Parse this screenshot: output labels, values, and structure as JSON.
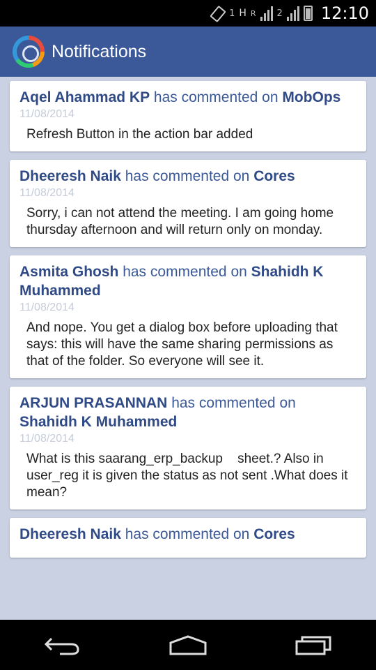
{
  "status_bar": {
    "sim1": "1",
    "net1": "H",
    "roam": "R",
    "sim2": "2",
    "time": "12:10",
    "icons": [
      "screen-rotation-icon",
      "signal-icon",
      "signal-icon",
      "battery-icon"
    ]
  },
  "app_bar": {
    "title": "Notifications",
    "logo_icon": "app-logo-icon"
  },
  "notifications": [
    {
      "author": "Aqel Ahammad KP",
      "action": " has commented on ",
      "target": "MobOps",
      "date": "11/08/2014",
      "message": "Refresh Button in the action bar added"
    },
    {
      "author": "Dheeresh Naik",
      "action": " has commented on ",
      "target": "Cores",
      "date": "11/08/2014",
      "message": "Sorry, i can not attend the meeting. I am going home thursday afternoon and will return only on monday."
    },
    {
      "author": "Asmita Ghosh",
      "action": " has commented on ",
      "target": "Shahidh K Muhammed",
      "date": "11/08/2014",
      "message": "And nope. You get a dialog box before uploading that says: this will have the same sharing permissions as that of the folder. So everyone will see it."
    },
    {
      "author": "ARJUN PRASANNAN",
      "action": " has commented on ",
      "target": "Shahidh K Muhammed",
      "date": "11/08/2014",
      "message": "What is this saarang_erp_backup    sheet.? Also in user_reg it is given the status as not sent .What does it mean?"
    },
    {
      "author": "Dheeresh Naik",
      "action": " has commented on ",
      "target": "Cores",
      "date": "",
      "message": ""
    }
  ],
  "nav_bar": {
    "icons": [
      "back-icon",
      "home-icon",
      "recent-apps-icon"
    ]
  },
  "colors": {
    "app_bar": "#3b5998",
    "background": "#c9d1e3",
    "headline": "#3b5998",
    "date": "#c6ccd8"
  }
}
